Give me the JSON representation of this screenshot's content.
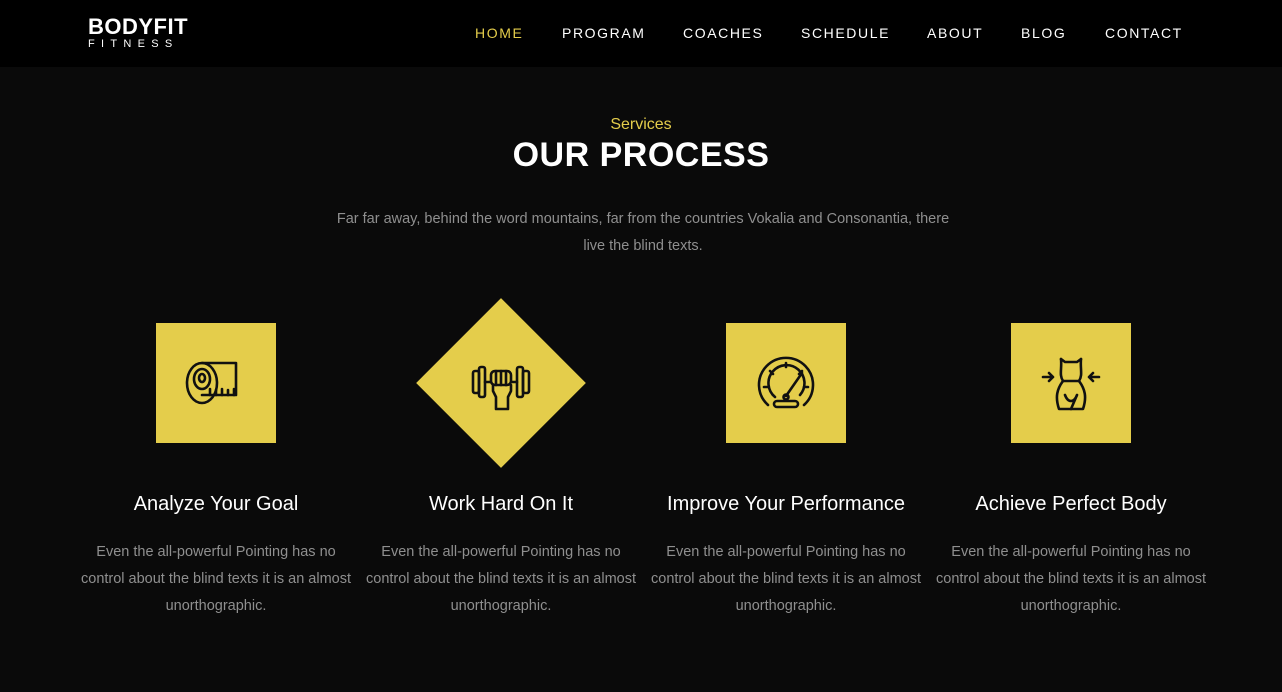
{
  "brand": {
    "name": "BODYFIT",
    "tagline": "FITNESS"
  },
  "nav": {
    "items": [
      {
        "label": "HOME",
        "active": true
      },
      {
        "label": "PROGRAM",
        "active": false
      },
      {
        "label": "COACHES",
        "active": false
      },
      {
        "label": "SCHEDULE",
        "active": false
      },
      {
        "label": "ABOUT",
        "active": false
      },
      {
        "label": "BLOG",
        "active": false
      },
      {
        "label": "CONTACT",
        "active": false
      }
    ]
  },
  "section": {
    "subheading": "Services",
    "title": "OUR PROCESS",
    "description": "Far far away, behind the word mountains, far from the countries Vokalia and Consonantia, there live the blind texts."
  },
  "services": [
    {
      "icon": "measuring-tape-icon",
      "title": "Analyze Your Goal",
      "text": "Even the all-powerful Pointing has no control about the blind texts it is an almost unorthographic."
    },
    {
      "icon": "dumbbell-fist-icon",
      "title": "Work Hard On It",
      "text": "Even the all-powerful Pointing has no control about the blind texts it is an almost unorthographic."
    },
    {
      "icon": "speedometer-icon",
      "title": "Improve Your Performance",
      "text": "Even the all-powerful Pointing has no control about the blind texts it is an almost unorthographic."
    },
    {
      "icon": "body-waist-icon",
      "title": "Achieve Perfect Body",
      "text": "Even the all-powerful Pointing has no control about the blind texts it is an almost unorthographic."
    }
  ],
  "colors": {
    "accent": "#e4cd4b",
    "background": "#0a0a0a",
    "navbar": "#000000",
    "muted_text": "#8f8f8f"
  }
}
